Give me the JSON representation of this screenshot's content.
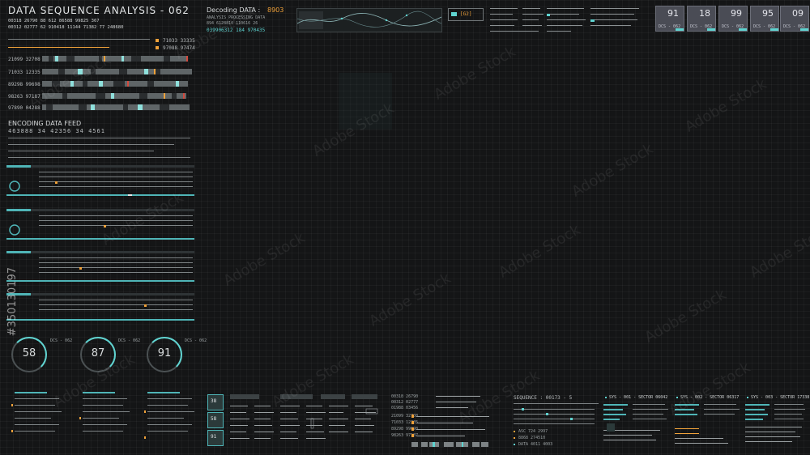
{
  "header": {
    "title": "DATA SEQUENCE ANALYSIS - 062",
    "row1": "00318 26790 88 612 86588 99825 367",
    "row2": "00312 02777 62 910418 11144 71382 77 248680",
    "decoding_label": "Decoding DATA :",
    "decoding_value": "8903",
    "analysis_label": "ANALYSIS PROCESSING DATA",
    "analysis_row": "894 6128810 110616 26",
    "stream_id": "039906312 184 970435",
    "scan_code": "[G2]"
  },
  "tiles": [
    {
      "value": "91",
      "label": "DCS - 062"
    },
    {
      "value": "18",
      "label": "DCS - 062"
    },
    {
      "value": "99",
      "label": "DCS - 062"
    },
    {
      "value": "95",
      "label": "DCS - 062"
    },
    {
      "value": "09",
      "label": "DCS - 062"
    }
  ],
  "left_panel": {
    "top_pair": [
      "71033 33335",
      "97088 97474"
    ],
    "rows": [
      "21099 32708",
      "71033 12335",
      "89298 99698",
      "98263 97187",
      "97890 04288"
    ],
    "encoding_title": "ENCODING DATA FEED",
    "encoding_row": "463888 34 42356 34 4561",
    "gauges": [
      {
        "value": "58",
        "label": "DCS - 062"
      },
      {
        "value": "87",
        "label": "DCS - 062"
      },
      {
        "value": "91",
        "label": "DCS - 062"
      }
    ]
  },
  "bottom": {
    "small_tiles": [
      "38",
      "58",
      "91"
    ],
    "mid_rows": [
      "00318 26790",
      "00312 02777",
      "01988 03456"
    ],
    "bar_rows": [
      "21099 32708",
      "71033 12335",
      "89298 99698",
      "98263 97187"
    ],
    "sequence_label": "SEQUENCE : 00173 - 5",
    "seq_rows": [
      "ASC 724 2997",
      "8868 274510",
      "DATA 4011 4003"
    ],
    "sys_headers": [
      "SYS - 001 - SECTOR 06042",
      "SYS - 002 - SECTOR 06317",
      "SYS - 003 - SECTOR 17338"
    ]
  },
  "watermark": {
    "text": "Adobe Stock",
    "id": "#350130197"
  },
  "colors": {
    "background": "#141516",
    "accent_teal": "#5fd3d0",
    "accent_orange": "#f0a23a",
    "tile_fill": "#4a4c55"
  }
}
